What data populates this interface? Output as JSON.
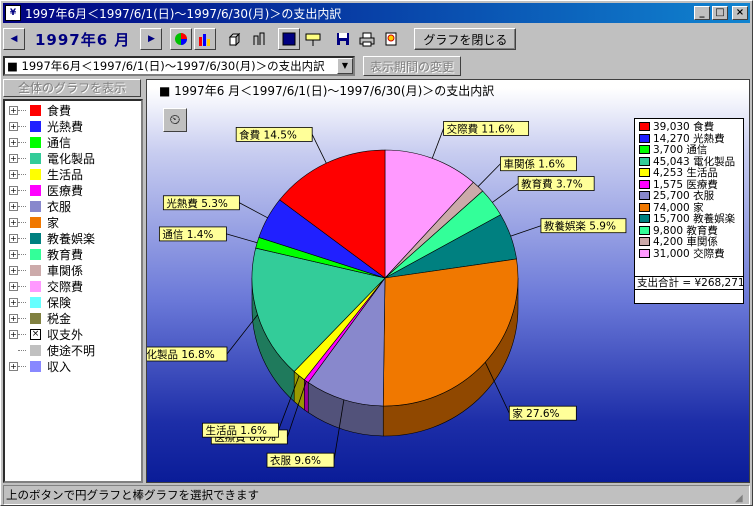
{
  "window": {
    "title": "1997年6月＜1997/6/1(日)～1997/6/30(月)＞の支出内訳",
    "app_icon": "kakeibo-app-icon",
    "controls": {
      "minimize": "_",
      "maximize": "□",
      "close": "×"
    }
  },
  "toolbar": {
    "prev_label": "◀",
    "month_label": "1997年6 月",
    "next_label": "▶",
    "close_graph_label": "グラフを閉じる",
    "icons": [
      "pie-chart-icon",
      "bar-chart-icon",
      "3d-box-icon",
      "2d-bar-icon",
      "background-color-icon",
      "label-tag-icon",
      "save-icon",
      "print-icon",
      "print-preview-icon"
    ]
  },
  "period": {
    "selected": "■ 1997年6月＜1997/6/1(日)～1997/6/30(月)＞の支出内訳",
    "change_button": "表示期間の変更"
  },
  "tree": {
    "show_all_button": "全体のグラフを表示",
    "items": [
      {
        "label": "食費",
        "color": "#ff0000",
        "type": "swatch"
      },
      {
        "label": "光熱費",
        "color": "#2020ff",
        "type": "swatch"
      },
      {
        "label": "通信",
        "color": "#00ff00",
        "type": "swatch"
      },
      {
        "label": "電化製品",
        "color": "#33cc99",
        "type": "swatch"
      },
      {
        "label": "生活品",
        "color": "#ffff00",
        "type": "swatch"
      },
      {
        "label": "医療費",
        "color": "#ff00ff",
        "type": "swatch"
      },
      {
        "label": "衣服",
        "color": "#8888cc",
        "type": "swatch"
      },
      {
        "label": "家",
        "color": "#f07800",
        "type": "swatch"
      },
      {
        "label": "教養娯楽",
        "color": "#008080",
        "type": "swatch"
      },
      {
        "label": "教育費",
        "color": "#33ff99",
        "type": "swatch"
      },
      {
        "label": "車関係",
        "color": "#ccaaaa",
        "type": "swatch"
      },
      {
        "label": "交際費",
        "color": "#ff99ff",
        "type": "swatch"
      },
      {
        "label": "保険",
        "color": "#66ffff",
        "type": "swatch"
      },
      {
        "label": "税金",
        "color": "#808040",
        "type": "swatch"
      },
      {
        "label": "収支外",
        "color": "#ffffff",
        "type": "xbox"
      },
      {
        "label": "使途不明",
        "color": "#c0c0c0",
        "type": "swatch",
        "leaf": true
      },
      {
        "label": "収入",
        "color": "#8888ff",
        "type": "swatch"
      }
    ]
  },
  "chart_title": "■ 1997年6 月＜1997/6/1(日)～1997/6/30(月)＞の支出内訳",
  "chart_data": {
    "type": "pie",
    "title": "■ 1997年6 月＜1997/6/1(日)～1997/6/30(月)＞の支出内訳",
    "slices": [
      {
        "label": "交際費",
        "value": 31000,
        "percent": "11.6%",
        "color": "#ff99ff"
      },
      {
        "label": "車関係",
        "value": 4200,
        "percent": "1.6%",
        "color": "#ccaaaa"
      },
      {
        "label": "教育費",
        "value": 9800,
        "percent": "3.7%",
        "color": "#33ff99"
      },
      {
        "label": "教養娯楽",
        "value": 15700,
        "percent": "5.9%",
        "color": "#008080"
      },
      {
        "label": "家",
        "value": 74000,
        "percent": "27.6%",
        "color": "#f07800"
      },
      {
        "label": "衣服",
        "value": 25700,
        "percent": "9.6%",
        "color": "#8888cc"
      },
      {
        "label": "医療費",
        "value": 1575,
        "percent": "0.6%",
        "color": "#ff00ff"
      },
      {
        "label": "生活品",
        "value": 4253,
        "percent": "1.6%",
        "color": "#ffff00"
      },
      {
        "label": "電化製品",
        "value": 45043,
        "percent": "16.8%",
        "color": "#33cc99"
      },
      {
        "label": "通信",
        "value": 3700,
        "percent": "1.4%",
        "color": "#00ff00"
      },
      {
        "label": "光熱費",
        "value": 14270,
        "percent": "5.3%",
        "color": "#2020ff"
      },
      {
        "label": "食費",
        "value": 39030,
        "percent": "14.5%",
        "color": "#ff0000"
      }
    ],
    "legend": [
      {
        "text": "39,030 食費",
        "color": "#ff0000"
      },
      {
        "text": "14,270 光熱費",
        "color": "#2020ff"
      },
      {
        "text": "3,700 通信",
        "color": "#00ff00"
      },
      {
        "text": "45,043 電化製品",
        "color": "#33cc99"
      },
      {
        "text": "4,253 生活品",
        "color": "#ffff00"
      },
      {
        "text": "1,575 医療費",
        "color": "#ff00ff"
      },
      {
        "text": "25,700 衣服",
        "color": "#8888cc"
      },
      {
        "text": "74,000 家",
        "color": "#f07800"
      },
      {
        "text": "15,700 教養娯楽",
        "color": "#008080"
      },
      {
        "text": "9,800 教育費",
        "color": "#33ff99"
      },
      {
        "text": "4,200 車関係",
        "color": "#ccaaaa"
      },
      {
        "text": "31,000 交際費",
        "color": "#ff99ff"
      }
    ],
    "legend_placement": "right",
    "total_label": "支出合計 = ¥268,271"
  },
  "status": "上のボタンで円グラフと棒グラフを選択できます"
}
